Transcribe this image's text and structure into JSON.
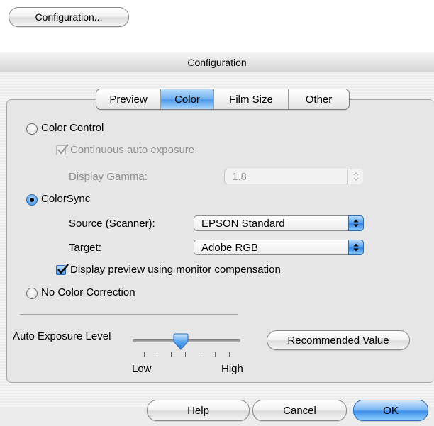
{
  "top_button": {
    "label": "Configuration..."
  },
  "window": {
    "title": "Configuration"
  },
  "tabs": [
    {
      "label": "Preview",
      "active": false
    },
    {
      "label": "Color",
      "active": true
    },
    {
      "label": "Film Size",
      "active": false
    },
    {
      "label": "Other",
      "active": false
    }
  ],
  "color_control": {
    "label": "Color Control",
    "selected": false,
    "continuous_auto_exposure": {
      "label": "Continuous auto exposure",
      "checked": true,
      "enabled": false
    },
    "display_gamma": {
      "label": "Display Gamma:",
      "value": "1.8",
      "enabled": false
    }
  },
  "colorsync": {
    "label": "ColorSync",
    "selected": true,
    "source": {
      "label": "Source (Scanner):",
      "value": "EPSON Standard"
    },
    "target": {
      "label": "Target:",
      "value": "Adobe RGB"
    },
    "monitor_compensation": {
      "label": "Display preview using monitor compensation",
      "checked": true
    }
  },
  "no_color_correction": {
    "label": "No Color Correction",
    "selected": false
  },
  "auto_exposure": {
    "label": "Auto Exposure Level",
    "low_label": "Low",
    "high_label": "High",
    "level": 0.45,
    "recommended_button": "Recommended Value"
  },
  "buttons": {
    "help": "Help",
    "cancel": "Cancel",
    "ok": "OK"
  },
  "colors": {
    "accent": "#4b98ea",
    "window_bg": "#ececec"
  }
}
